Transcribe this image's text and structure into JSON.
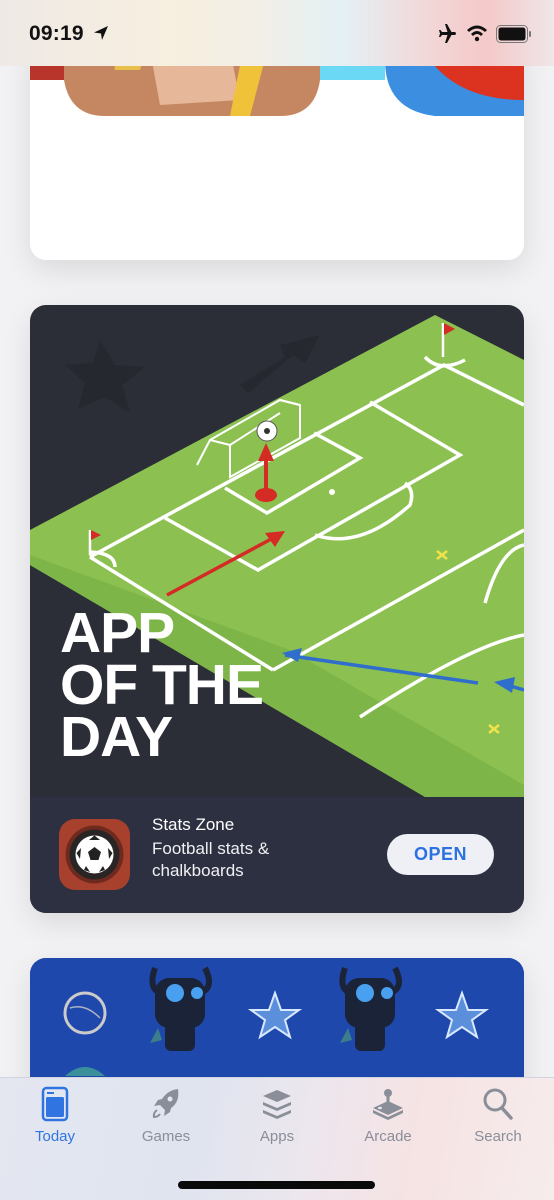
{
  "status_bar": {
    "time": "09:19",
    "icons": [
      "location-arrow-icon",
      "airplane-mode-icon",
      "wifi-icon",
      "battery-icon"
    ]
  },
  "cards": {
    "app_of_the_day": {
      "title_lines": [
        "APP",
        "OF THE",
        "DAY"
      ],
      "app": {
        "name": "Stats Zone",
        "subtitle": "Football stats & chalkboards",
        "icon": "soccer-ball-icon",
        "button_label": "OPEN"
      }
    }
  },
  "colors": {
    "accent": "#2f74e0",
    "card_dark": "#2b2d37",
    "pitch_green": "#8cc152",
    "app_icon_bg": "#a8402e"
  },
  "tab_bar": {
    "tabs": [
      {
        "label": "Today",
        "icon": "today-icon",
        "active": true
      },
      {
        "label": "Games",
        "icon": "rocket-icon",
        "active": false
      },
      {
        "label": "Apps",
        "icon": "layers-icon",
        "active": false
      },
      {
        "label": "Arcade",
        "icon": "joystick-icon",
        "active": false
      },
      {
        "label": "Search",
        "icon": "search-icon",
        "active": false
      }
    ]
  }
}
